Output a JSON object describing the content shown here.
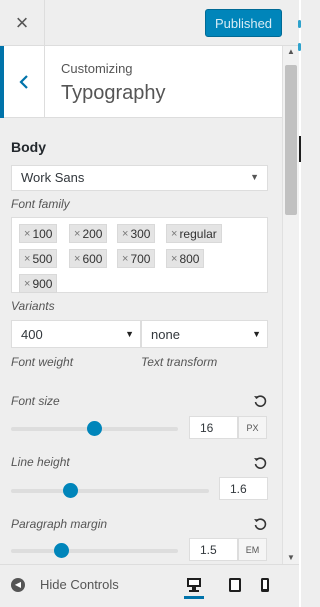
{
  "topbar": {
    "close_glyph": "×",
    "publish_label": "Published"
  },
  "header": {
    "customizing_label": "Customizing",
    "section_title": "Typography",
    "back_glyph": "‹"
  },
  "body_settings": {
    "heading": "Body",
    "font_family_value": "Work Sans",
    "font_family_label": "Font family",
    "variants": [
      "100",
      "200",
      "300",
      "regular",
      "500",
      "600",
      "700",
      "800",
      "900"
    ],
    "variants_label": "Variants",
    "font_weight_value": "400",
    "font_weight_label": "Font weight",
    "text_transform_value": "none",
    "text_transform_label": "Text transform",
    "font_size": {
      "label": "Font size",
      "value": "16",
      "unit": "PX",
      "slider_fraction": 0.5
    },
    "line_height": {
      "label": "Line height",
      "value": "1.6",
      "slider_fraction": 0.3
    },
    "paragraph_margin": {
      "label": "Paragraph margin",
      "value": "1.5",
      "unit": "EM",
      "slider_fraction": 0.3
    }
  },
  "footer": {
    "hide_controls_label": "Hide Controls"
  },
  "icons": [
    "close-icon",
    "back-chevron-icon",
    "chevron-down-icon",
    "reset-icon",
    "scroll-up-icon",
    "scroll-down-icon",
    "collapse-icon",
    "desktop-icon",
    "tablet-icon",
    "mobile-icon"
  ],
  "colors": {
    "accent": "#0085ba",
    "link": "#0073aa"
  }
}
